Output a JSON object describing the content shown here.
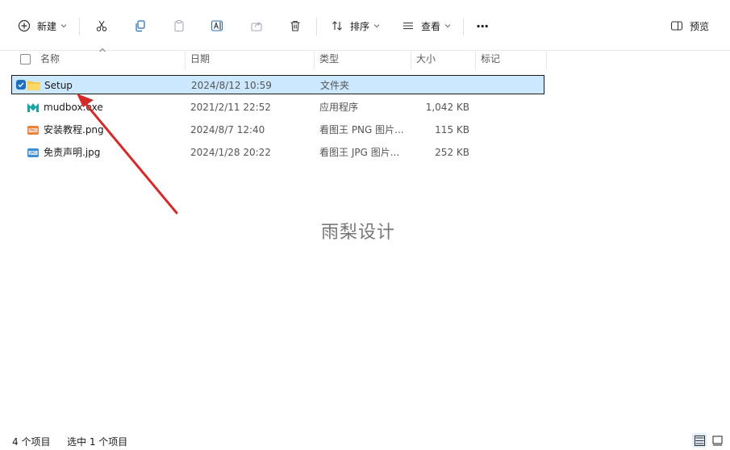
{
  "toolbar": {
    "new_label": "新建",
    "sort_label": "排序",
    "view_label": "查看",
    "more_label": "···",
    "preview_label": "预览"
  },
  "columns": {
    "name": "名称",
    "date": "日期",
    "type": "类型",
    "size": "大小",
    "tags": "标记"
  },
  "files": [
    {
      "name": "Setup",
      "date": "2024/8/12 10:59",
      "type": "文件夹",
      "size": "",
      "icon": "folder-icon",
      "selected": true
    },
    {
      "name": "mudbox.exe",
      "date": "2021/2/11 22:52",
      "type": "应用程序",
      "size": "1,042 KB",
      "icon": "mudbox-app-icon",
      "selected": false
    },
    {
      "name": "安装教程.png",
      "date": "2024/8/7 12:40",
      "type": "看图王 PNG 图片...",
      "size": "115 KB",
      "icon": "png-file-icon",
      "selected": false
    },
    {
      "name": "免责声明.jpg",
      "date": "2024/1/28 20:22",
      "type": "看图王 JPG 图片...",
      "size": "252 KB",
      "icon": "jpg-file-icon",
      "selected": false
    }
  ],
  "watermark": "雨梨设计",
  "status": {
    "item_count": "4 个项目",
    "selected_count": "选中 1 个项目"
  },
  "colors": {
    "selection": "#cce8ff",
    "folder": "#f8c847",
    "annotation_arrow": "#d42a2a"
  }
}
